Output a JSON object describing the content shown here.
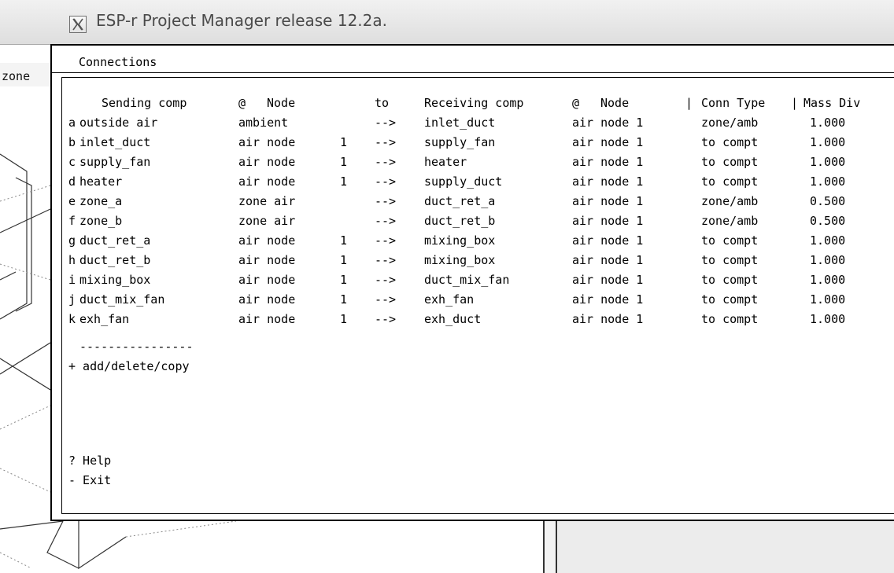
{
  "window": {
    "title": "ESP-r Project Manager release 12.2a.",
    "icon": "x-window-icon"
  },
  "background": {
    "side_label": "zone"
  },
  "dialog": {
    "title": "Connections",
    "headers": {
      "sending": "Sending comp",
      "at1": "@",
      "node1": "Node",
      "to": "to",
      "receiving": "Receiving comp",
      "at2": "@",
      "node2": "Node",
      "bar1": "|",
      "conn_type": "Conn Type",
      "bar2": "|",
      "mass_div": "Mass Div"
    },
    "rows": [
      {
        "key": "a",
        "send": "outside air",
        "node": "ambient",
        "num": "",
        "to": "-->",
        "recv": "inlet_duct",
        "rnode": "air node 1",
        "type": "zone/amb",
        "div": "1.000"
      },
      {
        "key": "b",
        "send": "inlet_duct",
        "node": "air node",
        "num": "1",
        "to": "-->",
        "recv": "supply_fan",
        "rnode": "air node 1",
        "type": "to compt",
        "div": "1.000"
      },
      {
        "key": "c",
        "send": "supply_fan",
        "node": "air node",
        "num": "1",
        "to": "-->",
        "recv": "heater",
        "rnode": "air node 1",
        "type": "to compt",
        "div": "1.000"
      },
      {
        "key": "d",
        "send": "heater",
        "node": "air node",
        "num": "1",
        "to": "-->",
        "recv": "supply_duct",
        "rnode": "air node 1",
        "type": "to compt",
        "div": "1.000"
      },
      {
        "key": "e",
        "send": "zone_a",
        "node": "zone air",
        "num": "",
        "to": "-->",
        "recv": "duct_ret_a",
        "rnode": "air node 1",
        "type": "zone/amb",
        "div": "0.500"
      },
      {
        "key": "f",
        "send": "zone_b",
        "node": "zone air",
        "num": "",
        "to": "-->",
        "recv": "duct_ret_b",
        "rnode": "air node 1",
        "type": "zone/amb",
        "div": "0.500"
      },
      {
        "key": "g",
        "send": "duct_ret_a",
        "node": "air node",
        "num": "1",
        "to": "-->",
        "recv": "mixing_box",
        "rnode": "air node 1",
        "type": "to compt",
        "div": "1.000"
      },
      {
        "key": "h",
        "send": "duct_ret_b",
        "node": "air node",
        "num": "1",
        "to": "-->",
        "recv": "mixing_box",
        "rnode": "air node 1",
        "type": "to compt",
        "div": "1.000"
      },
      {
        "key": "i",
        "send": "mixing_box",
        "node": "air node",
        "num": "1",
        "to": "-->",
        "recv": "duct_mix_fan",
        "rnode": "air node 1",
        "type": "to compt",
        "div": "1.000"
      },
      {
        "key": "j",
        "send": "duct_mix_fan",
        "node": "air node",
        "num": "1",
        "to": "-->",
        "recv": "exh_fan",
        "rnode": "air node 1",
        "type": "to compt",
        "div": "1.000"
      },
      {
        "key": "k",
        "send": "exh_fan",
        "node": "air node",
        "num": "1",
        "to": "-->",
        "recv": "exh_duct",
        "rnode": "air node 1",
        "type": "to compt",
        "div": "1.000"
      }
    ],
    "separator": "----------------",
    "add_item": "+ add/delete/copy",
    "help_item": "? Help",
    "exit_item": "- Exit"
  }
}
